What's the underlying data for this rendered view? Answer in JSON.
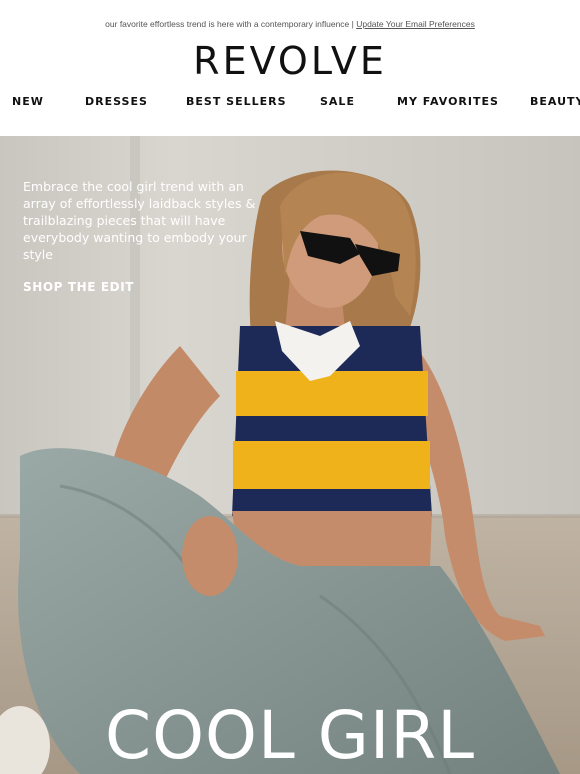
{
  "preheader": {
    "text": "our favorite effortless trend is here with a contemporary influence | ",
    "link_label": "Update Your Email Preferences"
  },
  "brand": {
    "logo_text": "REVOLVE"
  },
  "nav": {
    "items": [
      {
        "label": "NEW"
      },
      {
        "label": "DRESSES"
      },
      {
        "label": "BEST SELLERS"
      },
      {
        "label": "SALE"
      },
      {
        "label": "MY FAVORITES"
      },
      {
        "label": "BEAUTY"
      }
    ]
  },
  "hero": {
    "copy": "Embrace the cool girl trend with an array of effortlessly laidback styles & trailblazing pieces that will have everybody wanting to embody your style",
    "cta_label": "SHOP THE EDIT",
    "title": "COOL GIRL",
    "colors": {
      "wall": "#d6d3cd",
      "floor": "#b9ad9c",
      "stripe_navy": "#1d2a57",
      "stripe_yellow": "#f0b21b",
      "denim": "#8c9c99",
      "skin": "#c48c6a",
      "hair": "#a87a4a"
    }
  }
}
